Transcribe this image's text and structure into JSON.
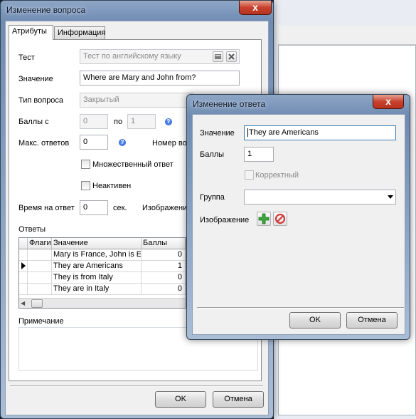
{
  "main_window": {
    "title": "Изменение вопроса",
    "close_glyph": "x",
    "tabs": [
      "Атрибуты",
      "Информация"
    ],
    "test_label": "Тест",
    "test_value": "Тест по английскому языку",
    "value_label": "Значение",
    "value_value": "Where are Mary and John from?",
    "qtype_label": "Тип вопроса",
    "qtype_value": "Закрытый",
    "score_from_label": "Баллы с",
    "score_from_value": "0",
    "score_to_label": "по",
    "score_to_value": "1",
    "max_answers_label": "Макс. ответов",
    "max_answers_value": "0",
    "number_label": "Номер воп",
    "multiple_label": "Множественный ответ",
    "inactive_label": "Неактивен",
    "time_label": "Время на ответ",
    "time_value": "0",
    "time_unit": "сек.",
    "image_label": "Изображени",
    "answers_label": "Ответы",
    "grid_headers": [
      "Флаги",
      "Значение",
      "Баллы"
    ],
    "answers": [
      {
        "value": "Mary is France, John is England",
        "score": "0"
      },
      {
        "value": "They are Americans",
        "score": "1"
      },
      {
        "value": "They is from Italy",
        "score": "0"
      },
      {
        "value": "They are in Italy",
        "score": "0"
      }
    ],
    "note_label": "Примечание",
    "ok_label": "OK",
    "cancel_label": "Отмена"
  },
  "answer_dialog": {
    "title": "Изменение ответа",
    "close_glyph": "x",
    "value_label": "Значение",
    "value_value": "They are Americans",
    "score_label": "Баллы",
    "score_value": "1",
    "correct_label": "Корректный",
    "group_label": "Группа",
    "group_value": "",
    "image_label": "Изображение",
    "ok_label": "OK",
    "cancel_label": "Отмена"
  },
  "icons": [
    "open-icon",
    "clear-icon",
    "help-icon",
    "add-icon",
    "remove-icon",
    "row-pointer-icon",
    "scroll-left-icon"
  ],
  "colors": {
    "title_bar": "#7a94b8",
    "close_button": "#c7422e",
    "add_green": "#3aa83a",
    "remove_red": "#d23a3a"
  }
}
